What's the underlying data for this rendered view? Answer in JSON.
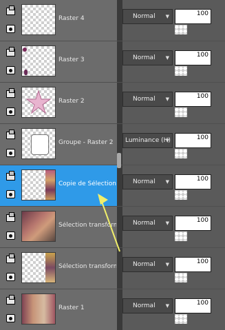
{
  "layers": [
    {
      "name": "Raster 4",
      "blend": "Normal",
      "opacity": "100",
      "selected": false,
      "thumb": "checker"
    },
    {
      "name": "Raster 3",
      "blend": "Normal",
      "opacity": "100",
      "selected": false,
      "thumb": "corner-flowers"
    },
    {
      "name": "Raster 2",
      "blend": "Normal",
      "opacity": "100",
      "selected": false,
      "thumb": "star"
    },
    {
      "name": "Groupe - Raster 2",
      "blend": "Luminance (H)",
      "opacity": "100",
      "selected": false,
      "thumb": "white-shape"
    },
    {
      "name": "Copie de Sélection tra",
      "blend": "Normal",
      "opacity": "100",
      "selected": true,
      "thumb": "right-strip"
    },
    {
      "name": "Sélection transformée",
      "blend": "Normal",
      "opacity": "100",
      "selected": false,
      "thumb": "photo"
    },
    {
      "name": "Sélection transformée",
      "blend": "Normal",
      "opacity": "100",
      "selected": false,
      "thumb": "right-strip-dark"
    },
    {
      "name": "Raster 1",
      "blend": "Normal",
      "opacity": "100",
      "selected": false,
      "thumb": "photo2"
    }
  ],
  "colors": {
    "selected": "#2f9ae8",
    "arrow": "#f1ef6b",
    "panel": "#6c6c6c"
  },
  "icons": {
    "layer_type": "layer-stack-icon",
    "visibility": "eye-icon",
    "dropdown": "chevron-down-icon"
  }
}
